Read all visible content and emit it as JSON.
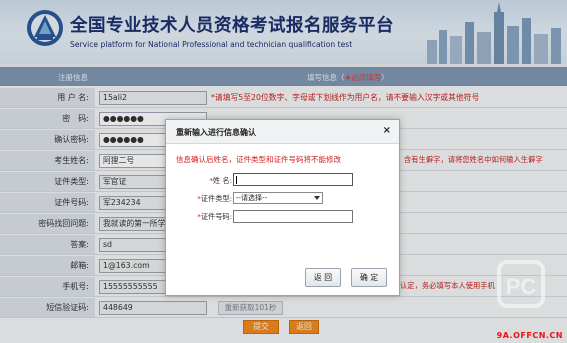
{
  "site": {
    "title": "全国专业技术人员资格考试报名服务平台",
    "subtitle": "Service platform for National Professional and technician  qualification test"
  },
  "form": {
    "header_left": "注册信息",
    "header_right_prefix": "填写信息（",
    "header_required": "★必须填写",
    "header_right_suffix": "）",
    "rows": [
      {
        "label": "用 户 名:",
        "value": "15ali2",
        "hint": "*请填写5至20位数字、字母或下划线作为用户名，请不要输入汉字或其他符号"
      },
      {
        "label": "密　码:",
        "value": "●●●●●●"
      },
      {
        "label": "确认密码:",
        "value": "●●●●●●"
      },
      {
        "label": "考生姓名:",
        "value": "阿狸二号",
        "hint_right": "含有生僻字，请将您姓名中如何输入生僻字"
      },
      {
        "label": "证件类型:",
        "value": "军官证"
      },
      {
        "label": "证件号码:",
        "value": "军234234"
      },
      {
        "label": "密码找回问题:",
        "value": "我就读的第一所学"
      },
      {
        "label": "答案:",
        "value": "sd"
      },
      {
        "label": "邮箱:",
        "value": "1@163.com"
      },
      {
        "label": "手机号:",
        "value": "15555555555",
        "hint_right": "认定，务必填写本人使用手机"
      },
      {
        "label": "短信验证码:",
        "value": "448649",
        "sms_button": "重新获取101秒"
      }
    ],
    "submit_label": "提交",
    "back_label": "返回"
  },
  "dialog": {
    "title": "重新输入进行信息确认",
    "close": "×",
    "notice": "信息确认后姓名，证件类型和证件号码将不能修改",
    "name_label": "姓  名:",
    "id_type_label": "证件类型:",
    "id_type_value": "--请选择--",
    "id_number_label": "证件号码:",
    "required_mark": "*",
    "back_button": "返 回",
    "confirm_button": "确 定"
  },
  "watermark": {
    "text": "9A.OFFCN.CN"
  },
  "colors": {
    "header_bar": "#7f98b3",
    "accent_orange": "#f1891e",
    "hint_red": "#cc1f1f"
  }
}
